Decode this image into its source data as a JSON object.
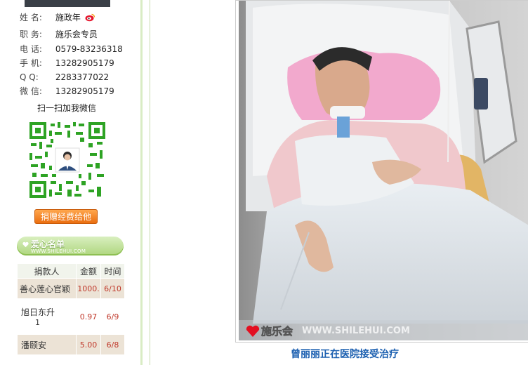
{
  "profile": {
    "rows": [
      {
        "label": "姓  名:",
        "value": "施政年"
      },
      {
        "label": "职  务:",
        "value": "施乐会专员"
      },
      {
        "label": "电  话:",
        "value": "0579-83236318"
      },
      {
        "label": "手  机:",
        "value": "13282905179"
      },
      {
        "label": "Q    Q:",
        "value": "2283377022"
      },
      {
        "label": "微  信:",
        "value": "13282905179"
      }
    ],
    "scan_text": "扫一扫加我微信",
    "donate_button": "捐赠经费给他"
  },
  "love_list": {
    "title": "爱心名单",
    "subtitle": "WWW.SHILEHUI.COM",
    "columns": [
      "捐款人",
      "金额",
      "时间"
    ],
    "rows": [
      {
        "name": "善心莲心官颖",
        "amount": "1000.",
        "date": "6/10"
      },
      {
        "name": "旭日东升",
        "name2": "1",
        "amount": "0.97",
        "date": "6/9"
      },
      {
        "name": "潘颐安",
        "amount": "5.00",
        "date": "6/8"
      }
    ]
  },
  "photo": {
    "watermark_brand": "施乐会",
    "watermark_url": "WWW.SHILEHUI.COM",
    "caption": "曾丽丽正在医院接受治疗"
  },
  "colors": {
    "link": "#1b5fb0",
    "accent_green": "#aed67e",
    "button_orange": "#ea6e10",
    "amount_red": "#c0392b"
  }
}
